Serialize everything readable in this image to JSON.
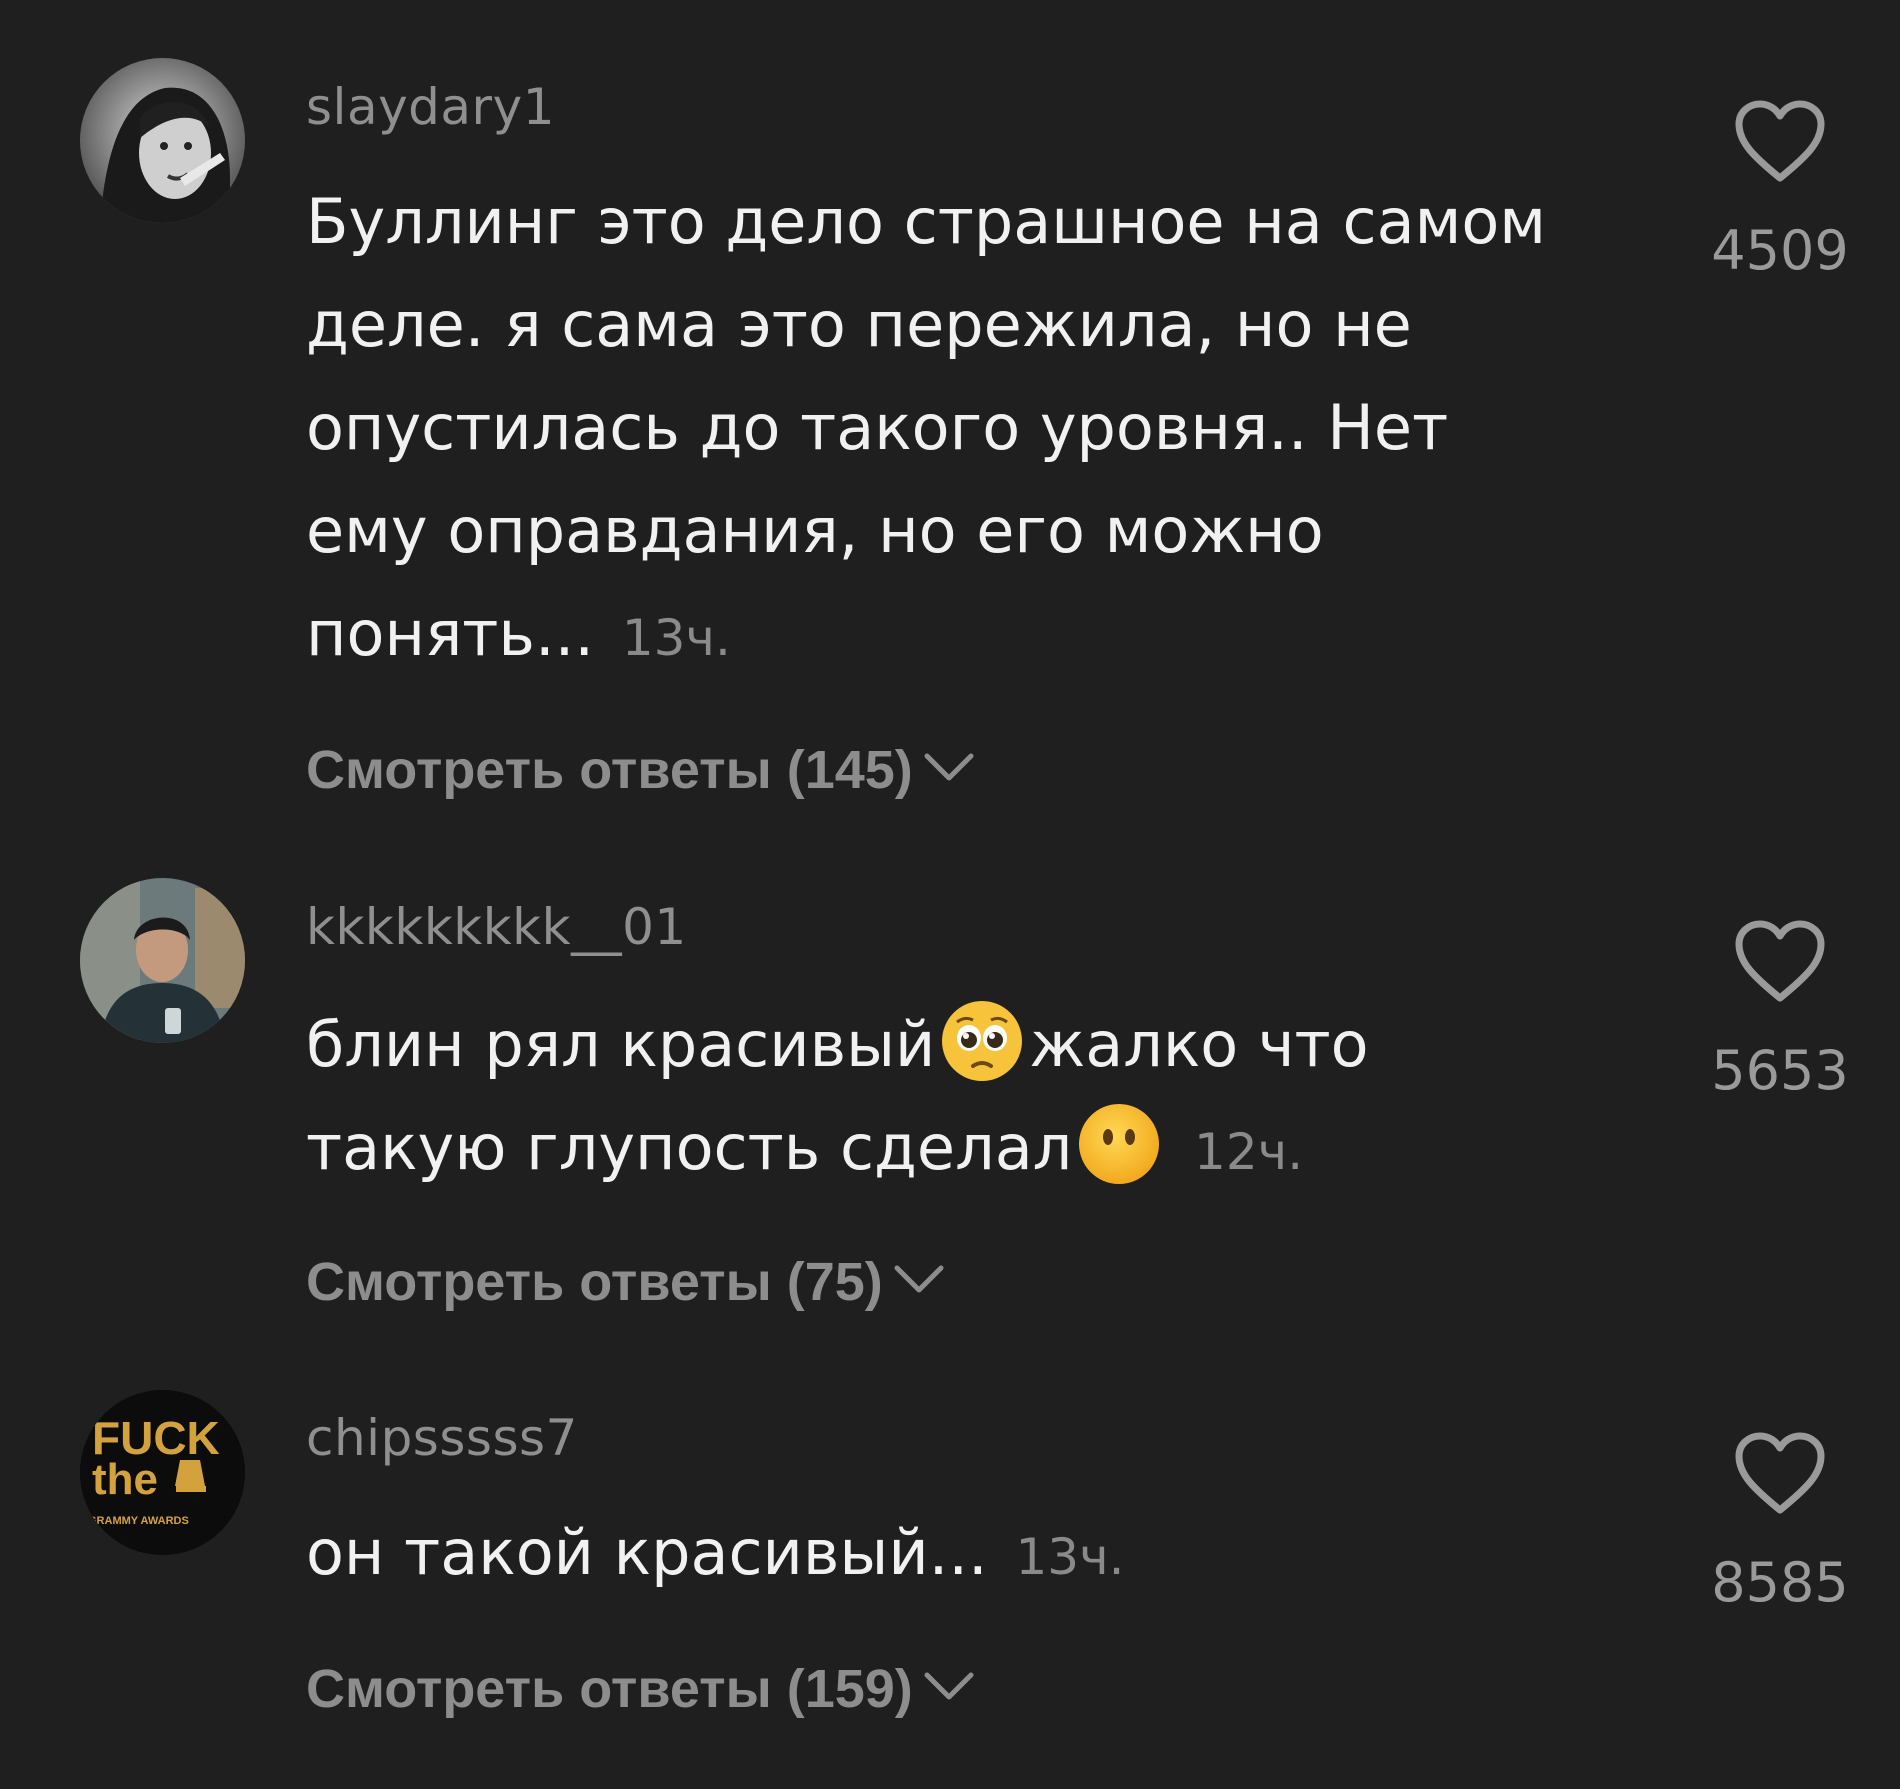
{
  "theme": {
    "background": "#1f1f1f",
    "text": "#f1f1f1",
    "muted": "#8f8f8f"
  },
  "comments": [
    {
      "username": "slaydary1",
      "avatar_icon": "user-avatar-photo",
      "lines": [
        "Буллинг это дело страшное на самом",
        "деле. я сама это пережила, но не",
        "опустилась до такого уровня.. Нет",
        "ему оправдания, но его можно",
        "понять..."
      ],
      "time": "13ч.",
      "replies_label": "Смотреть ответы (145)",
      "likes": "4509"
    },
    {
      "username": "kkkkkkkkk__01",
      "avatar_icon": "user-avatar-photo",
      "line1_text": "блин рял красивый",
      "line1_emoji": "pleading-face-emoji",
      "line1_after": "жалко что",
      "line2_text": "такую глупость сделал",
      "line2_emoji": "face-without-mouth-emoji",
      "time": "12ч.",
      "replies_label": "Смотреть ответы (75)",
      "likes": "5653"
    },
    {
      "username": "chipsssss7",
      "avatar_icon": "user-avatar-logo",
      "avatar_text": [
        "FUCK",
        "the",
        "GRAMMY AWARDS"
      ],
      "lines": [
        "он такой красивый..."
      ],
      "time": "13ч.",
      "replies_label": "Смотреть ответы (159)",
      "likes": "8585"
    }
  ]
}
